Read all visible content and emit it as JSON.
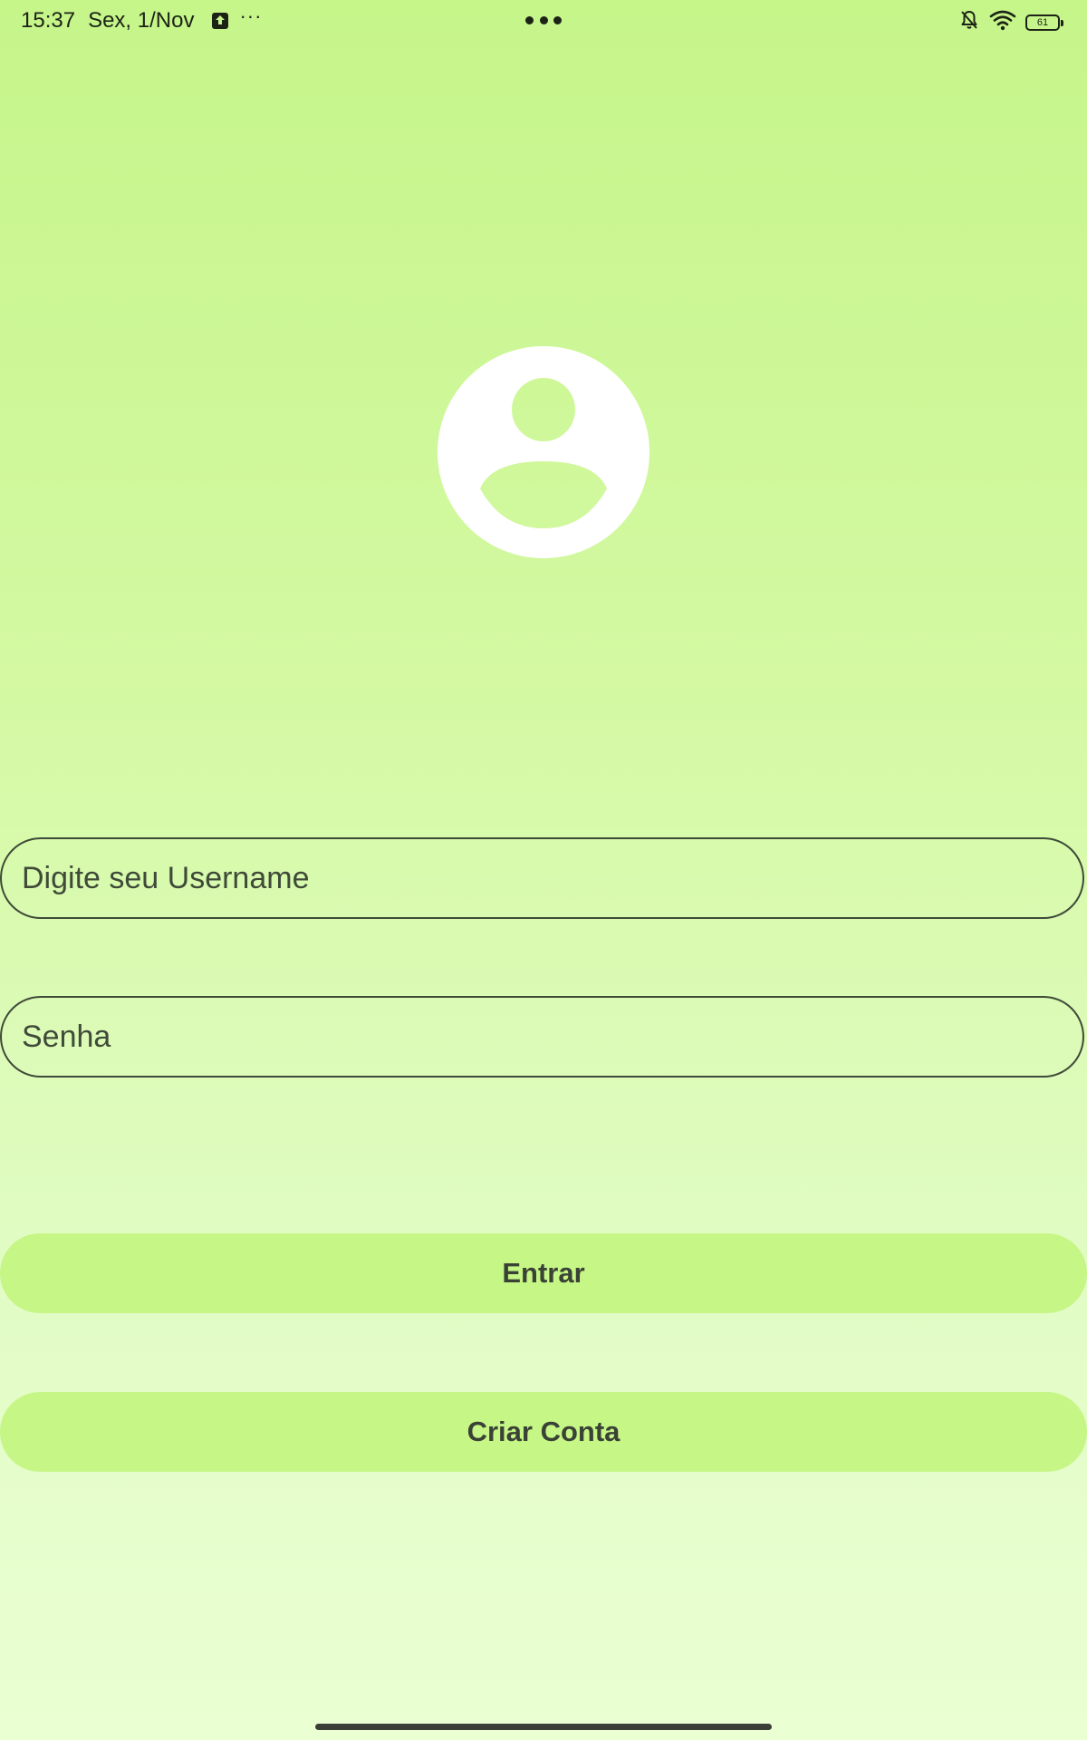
{
  "status_bar": {
    "time": "15:37",
    "date": "Sex, 1/Nov",
    "more_notifications": "···",
    "battery_level": "61",
    "icons": [
      "upload-notification-icon",
      "more-dots-icon",
      "bell-off-icon",
      "wifi-icon",
      "battery-icon"
    ]
  },
  "avatar": {
    "icon": "account-circle-icon",
    "color": "#ffffff"
  },
  "form": {
    "username_placeholder": "Digite seu Username",
    "username_value": "",
    "password_placeholder": "Senha",
    "password_value": ""
  },
  "buttons": {
    "login_label": "Entrar",
    "create_account_label": "Criar Conta"
  },
  "colors": {
    "background_top": "#c6f58a",
    "background_bottom": "#eaffd2",
    "button_fill": "#c6f686",
    "text": "#3a3f36"
  }
}
